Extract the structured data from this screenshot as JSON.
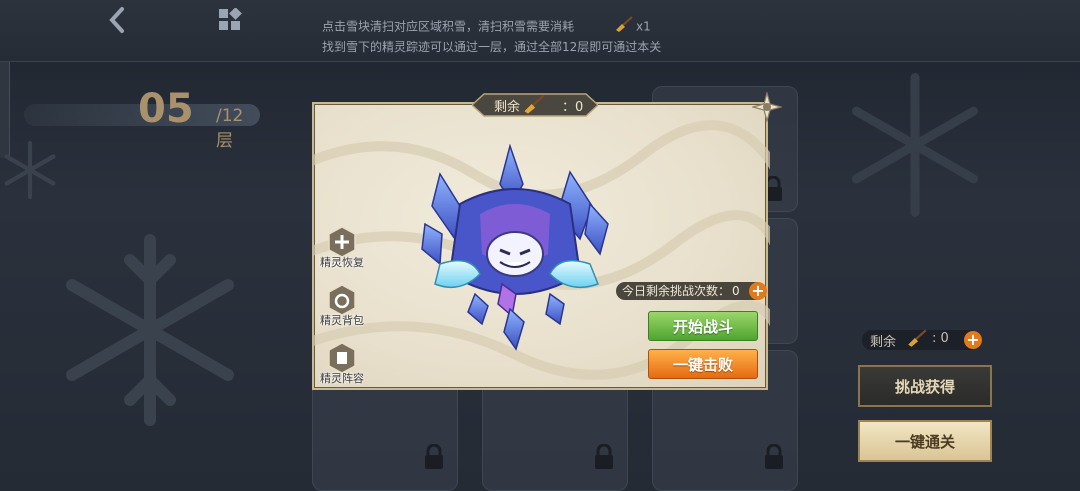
{
  "top": {
    "hint_line1_a": "点击雪块清扫对应区域积雪，清扫积雪需要消耗",
    "hint_cost": "x1",
    "hint_line2": "找到雪下的精灵踪迹可以通过一层，通过全部12层即可通过本关"
  },
  "floor": {
    "current": "05",
    "total": "/12层"
  },
  "modal": {
    "remaining_label": "剩余",
    "remaining_count": "：0",
    "side_buttons": [
      "精灵恢复",
      "精灵背包",
      "精灵阵容"
    ],
    "tries_label": "今日剩余挑战次数：",
    "tries_count": "0",
    "start_battle": "开始战斗",
    "one_click_defeat": "一键击败"
  },
  "right": {
    "remaining_label": "剩余",
    "remaining_count": ": 0",
    "challenge_reward": "挑战获得",
    "one_click_clear": "一键通关"
  },
  "colors": {
    "accent_gold": "#a9916c",
    "green_button": "#4fa531",
    "orange_button": "#e56b12",
    "plus": "#e07a1a"
  }
}
